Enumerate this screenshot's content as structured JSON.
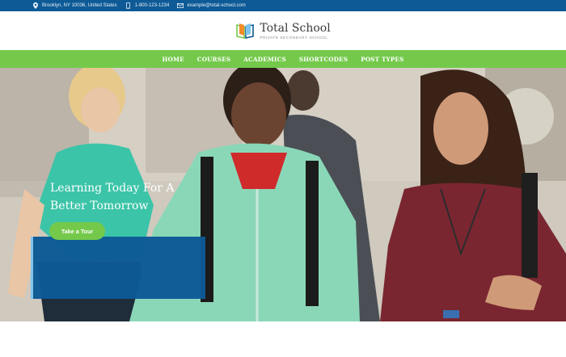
{
  "topbar": {
    "address": "Brooklyn, NY 10036, United States",
    "phone": "1-800-123-1234",
    "email": "example@total-school.com",
    "icons": [
      "map-pin-icon",
      "phone-icon",
      "mail-icon"
    ]
  },
  "brand": {
    "title": "Total School",
    "tagline": "PRIVATE SECONDARY SCHOOL",
    "colors": {
      "blue": "#0d5a96",
      "green": "#74c94b",
      "orange": "#f28c28",
      "lightblue": "#7fc4ef"
    }
  },
  "nav": {
    "items": [
      "HOME",
      "COURSES",
      "ACADEMICS",
      "SHORTCODES",
      "POST TYPES"
    ]
  },
  "hero": {
    "headline": "Learning Today For A Better Tomorrow",
    "cta_label": "Take a Tour"
  }
}
